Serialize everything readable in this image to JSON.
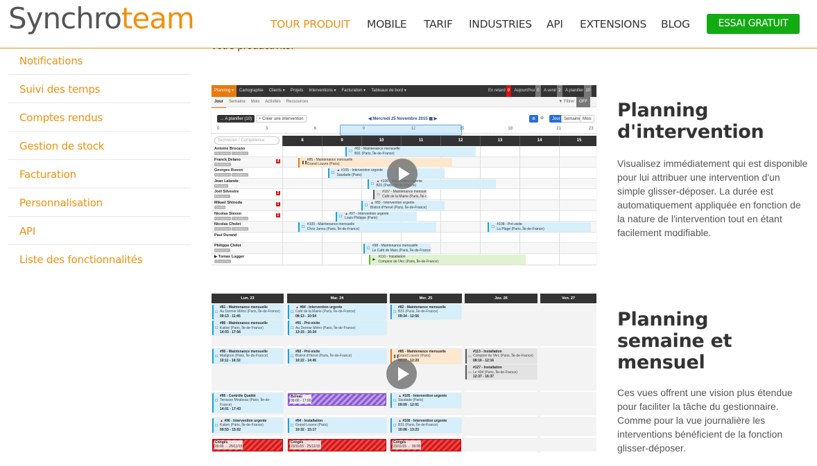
{
  "header": {
    "logo": {
      "part1": "Synchro",
      "part2": "team"
    },
    "nav": [
      {
        "label": "TOUR PRODUIT",
        "active": true
      },
      {
        "label": "MOBILE"
      },
      {
        "label": "TARIF"
      },
      {
        "label": "INDUSTRIES"
      },
      {
        "label": "API"
      },
      {
        "label": "EXTENSIONS"
      },
      {
        "label": "BLOG"
      }
    ],
    "cta": "ESSAI GRATUIT"
  },
  "clipped_text": "votre productivité.",
  "sidebar": {
    "items": [
      {
        "label": "Notifications"
      },
      {
        "label": "Suivi des temps"
      },
      {
        "label": "Comptes rendus"
      },
      {
        "label": "Gestion de stock"
      },
      {
        "label": "Facturation"
      },
      {
        "label": "Personnalisation"
      },
      {
        "label": "API"
      },
      {
        "label": "Liste des fonctionnalités"
      }
    ]
  },
  "features": [
    {
      "title": "Planning d'intervention",
      "text": "Visualisez immédiatement qui est disponible pour lui attribuer une intervention d'un simple glisser-déposer. La durée est automatiquement appliquée en fonction de la nature de l'intervention tout en étant facilement modifiable."
    },
    {
      "title": "Planning semaine et mensuel",
      "text": "Ces vues offrent une vision plus étendue pour faciliter la tâche du gestionnaire. Comme pour la vue journalière les interventions bénéficient de la fonction glisser-déposer."
    }
  ],
  "colors": {
    "brand": "#f0900f",
    "cta": "#12ab12",
    "dark": "#333333"
  },
  "day_view": {
    "menu": [
      "Planning ▾",
      "Cartographie",
      "Clients ▾",
      "Projets",
      "Interventions ▾",
      "Facturation ▾",
      "Tableaux de bord ▾"
    ],
    "counters": [
      {
        "label": "En retard",
        "value": "9",
        "red": true
      },
      {
        "label": "Aujourd'hui",
        "value": "0"
      },
      {
        "label": "A venir",
        "value": "2"
      },
      {
        "label": "A planifier",
        "value": "10"
      }
    ],
    "tabs": [
      "Jour",
      "Semaine",
      "Mois",
      "Activités",
      "Ressources"
    ],
    "filter": "▼ Filtrer",
    "filter_state": "OFF",
    "to_plan": "→ A planifier (10)",
    "create": "+ Créer une intervention",
    "date": "Mercredi 25 Novembre 2015",
    "view_buttons": [
      "Jour",
      "Semaine",
      "Mois"
    ],
    "ruler_labels": [
      "0",
      "3",
      "6",
      "9",
      "12",
      "15",
      "18",
      "21",
      "23"
    ],
    "search_placeholder": "Technicien / Compétence",
    "hours": [
      "8",
      "9",
      "10",
      "11",
      "12",
      "13",
      "14",
      "15"
    ],
    "technicians": [
      {
        "name": "Antoine Brocano",
        "tags": [
          "Climaticien",
          "Installateur"
        ]
      },
      {
        "name": "Franck Delano",
        "tags": [
          "Climaticien"
        ],
        "badge": "4"
      },
      {
        "name": "Georges Ruson",
        "tags": [
          "Climaticien",
          "Installateur"
        ]
      },
      {
        "name": "Jean Lalande",
        "tags": [
          "Plombier"
        ]
      },
      {
        "name": "Joël Silvestre",
        "tags": [
          "Electricien"
        ],
        "badge": "2"
      },
      {
        "name": "Mikael Shinoda",
        "tags": [
          "Qualité"
        ],
        "badge": "1"
      },
      {
        "name": "Nicolas Steven",
        "tags": [
          "Climaticien",
          "Installateur"
        ],
        "badge": "1"
      },
      {
        "name": "Nicolas Cholet",
        "tags": [
          "Climaticien",
          "Installateur"
        ]
      },
      {
        "name": "Paul Durand",
        "tags": []
      },
      {
        "name": "Philippe Chilot",
        "tags": [
          "Electricien"
        ]
      },
      {
        "name": "▶ Tomas Lugger",
        "tags": [
          "Climaticien"
        ]
      }
    ],
    "events": [
      {
        "row": 0,
        "start": 9.6,
        "end": 12.9,
        "title": "#82 - Maintenance mensuelle",
        "place": "B31 (Paris, Île-de-France)",
        "kind": "blue",
        "icon": "☐"
      },
      {
        "row": 1,
        "start": 8.4,
        "end": 12.3,
        "title": "#85 - Maintenance mensuelle",
        "place": "Grand Louvre (Paris)",
        "kind": "orange",
        "icon": "❚❚"
      },
      {
        "row": 2,
        "start": 9.15,
        "end": 12.1,
        "title": "▲ #105 - Intervention urgente",
        "place": "Saudade (Paris)",
        "kind": "blue",
        "icon": "☐"
      },
      {
        "row": 3,
        "start": 10.15,
        "end": 13.4,
        "title": "▲ #106 - Intervention urgente",
        "place": "B31 (Paris, Île-de-France)",
        "kind": "blue",
        "icon": "☐"
      },
      {
        "row": 4,
        "start": 10.3,
        "end": 11.65,
        "title": "#107 - Maintenance mensuelle",
        "place": "Café de la Mairie (Paris, Île-de-France)",
        "kind": "gray",
        "icon": "▭"
      },
      {
        "row": 5,
        "start": 10.0,
        "end": 12.1,
        "title": "▲ #83 - Intervention urgente",
        "place": "Bistrot d'Hervé (Paris, Île-de-France)",
        "kind": "blue",
        "icon": "☐"
      },
      {
        "row": 6,
        "start": 9.35,
        "end": 11.4,
        "title": "▲ #97 - Intervention urgente",
        "place": "Louis Philippe (Paris)",
        "kind": "blue",
        "icon": "☐"
      },
      {
        "row": 7,
        "start": 8.4,
        "end": 11.9,
        "title": "#100 - Maintenance mensuelle",
        "place": "Chez Janou (Paris, Île-de-France)",
        "kind": "blue",
        "icon": "☐"
      },
      {
        "row": 7,
        "start": 13.2,
        "end": 15.8,
        "title": "#108 - Pré-visite",
        "place": "La Plage (Paris, Île-de-France)",
        "kind": "blue",
        "icon": "☐"
      },
      {
        "row": 9,
        "start": 10.05,
        "end": 11.75,
        "title": "#98 - Maintenance mensuelle",
        "place": "Le Café de Mars (Paris, Île-de-France)",
        "kind": "blue",
        "icon": "☐"
      },
      {
        "row": 10,
        "start": 10.2,
        "end": 14.15,
        "title": "#110 - Installation",
        "place": "Comptoir de l'Arc (Paris, Île-de-France)",
        "kind": "green",
        "icon": "▶"
      }
    ]
  },
  "week_view": {
    "days": [
      "Lun. 23",
      "Mar. 24",
      "Mer. 25",
      "Jeu. 26",
      "Ven. 27"
    ],
    "rows": [
      [
        [
          {
            "t": "#81 - Maintenance mensuelle",
            "p": "Au Dernier Métro (Paris, Île-de-France)",
            "h": "09:13 - 11:45"
          },
          {
            "t": "#86 - Maintenance mensuelle",
            "p": "Kaiten (Paris, Île-de-France)",
            "h": "14:03 - 17:56"
          }
        ],
        [
          {
            "t": "▲ #84 - Intervention urgente",
            "p": "Café de la Mairie (Paris, Île-de-France)",
            "h": "08:13 - 10:54"
          },
          {
            "t": "#91 - Pré-visite",
            "p": "Au Dernier Métro (Paris, Île-de-France)",
            "h": "13:15 - 16:34"
          }
        ],
        [
          {
            "t": "#82 - Maintenance mensuelle",
            "p": "B31 (Paris, Île-de-France)",
            "h": "09:34 - 12:56"
          }
        ],
        [],
        []
      ],
      [
        [
          {
            "t": "#90 - Maintenance mensuelle",
            "p": "Matignon (Paris, Île-de-France)",
            "h": "10:11 - 16:32"
          }
        ],
        [
          {
            "t": "#92 - Pré-visite",
            "p": "Bistrot d'Hervé (Paris, Île-de-France)",
            "h": "10:22 - 14:45"
          }
        ],
        [
          {
            "t": "#85 - Maintenance mensuelle",
            "p": "Grand Louvre (Paris)",
            "h": "08:22 - 12:20",
            "k": "orange",
            "i": "❚❚"
          }
        ],
        [
          {
            "t": "#113 - Installation",
            "p": "Comptoir de l'Arc (Paris, Île-de-France)",
            "h": "08:16 - 12:16",
            "k": "gray",
            "i": "▭"
          },
          {
            "t": "#127 - Installation",
            "p": "Le 404 (Paris, Île-de-France)",
            "h": "12:37 - 16:37",
            "k": "gray",
            "i": "▭"
          }
        ],
        []
      ],
      [
        [
          {
            "t": "#95 - Contrôle Qualité",
            "p": "Terrasse Mirabeau (Paris, Île-de-France)",
            "h": "14:01 - 17:43"
          }
        ],
        [
          {
            "t": "Bureau",
            "h": "09:00 - 17:00",
            "k": "stripe purple"
          }
        ],
        [
          {
            "t": "▲ #105 - Intervention urgente",
            "p": "Saudade (Paris)",
            "h": "09:09 - 12:01"
          }
        ],
        [],
        []
      ],
      [
        [
          {
            "t": "▲ #96 - Intervention urgente",
            "p": "Kaiten (Paris, Île-de-France)",
            "h": "09:53 - 15:02"
          }
        ],
        [
          {
            "t": "#94 - Installation",
            "p": "Grand Louvre (Paris)",
            "h": "10:32 - 15:17"
          }
        ],
        [
          {
            "t": "▲ #106 - Intervention urgente",
            "p": "B31 (Paris, Île-de-France)",
            "h": "10:08 - 13:23"
          }
        ],
        [],
        []
      ],
      [
        [
          {
            "t": "Congés",
            "h": "00:00 → 25/11/15",
            "k": "stripe"
          }
        ],
        [
          {
            "t": "Congés",
            "h": "23/11/15 - 25/11/15",
            "k": "stripe"
          }
        ],
        [
          {
            "t": "Congés",
            "h": "23/11/15 ← 00:00",
            "k": "stripe"
          }
        ],
        [],
        []
      ]
    ]
  }
}
